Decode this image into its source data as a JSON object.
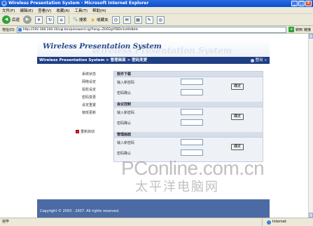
{
  "window": {
    "title": "Wireless Presentation System - Microsoft Internet Explorer",
    "controls": [
      "_",
      "□",
      "×"
    ]
  },
  "menu": [
    "文件(F)",
    "编辑(E)",
    "查看(V)",
    "收藏(A)",
    "工具(T)",
    "帮助(H)"
  ],
  "toolbar": {
    "back_label": "后退",
    "search_label": "搜索",
    "favorites_label": "收藏夹"
  },
  "address": {
    "label": "地址(D)",
    "url": "http://192.168.100.10/cgi-bin/password.cgi?lang=ZH02gYFBDr1sH0dbHc",
    "go_label": "转到",
    "links_label": "链接"
  },
  "page": {
    "brand_title": "Wireless Presentation System",
    "brand_ghost": "Wireless Presentation System",
    "breadcrumb": "Wireless Presentation System > 管理画面 > 密码变更",
    "logout_label": "登出",
    "sidebar": [
      "系统状态",
      "网络设定",
      "投影设定",
      "密码变更",
      "设定重置",
      "韧体更新"
    ],
    "sidebar_logout": "重新启动",
    "sections": [
      {
        "title": "软件下载",
        "field1": "输入新密码",
        "field2": "密码确认",
        "button": "确定"
      },
      {
        "title": "会议控制",
        "field1": "输入新密码",
        "field2": "密码确认",
        "button": "确定"
      },
      {
        "title": "管理画面",
        "field1": "输入新密码",
        "field2": "密码确认",
        "button": "确定"
      }
    ],
    "copyright": "Copyright © 2003 - 2007. All rights reserved."
  },
  "watermark": {
    "line1": "PConline.com.cn",
    "line2": "太平洋电脑网"
  },
  "status": {
    "left": "完毕",
    "zone": "Internet"
  }
}
